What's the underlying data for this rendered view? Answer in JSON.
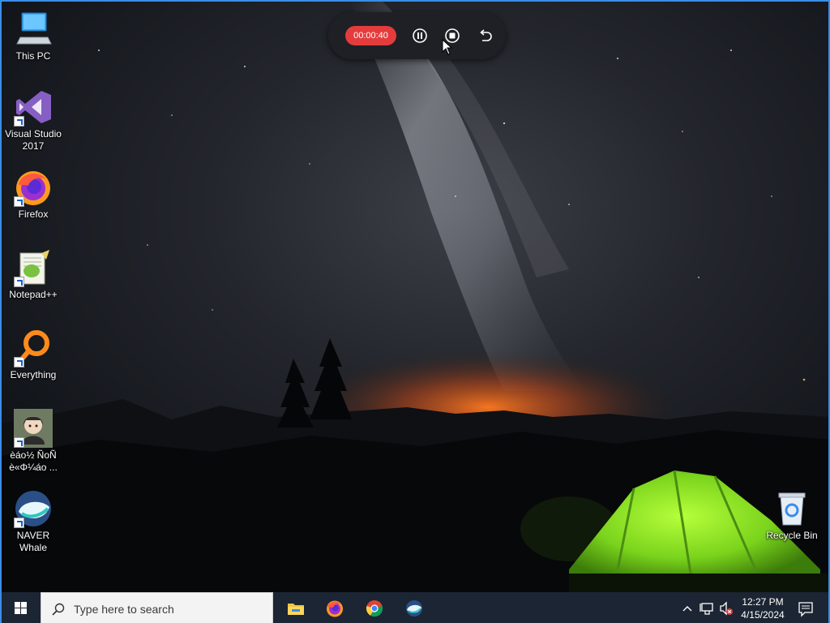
{
  "desktop": {
    "icons": [
      {
        "label": "This PC",
        "icon": "this-pc-icon"
      },
      {
        "label": "Visual Studio 2017",
        "icon": "visual-studio-icon"
      },
      {
        "label": "Firefox",
        "icon": "firefox-icon"
      },
      {
        "label": "Notepad++",
        "icon": "notepadpp-icon"
      },
      {
        "label": "Everything",
        "icon": "everything-icon"
      },
      {
        "label": "èáo½ ÑoÑ è«Φ¼áo ...",
        "icon": "user-avatar-icon"
      },
      {
        "label": "NAVER Whale",
        "icon": "naver-whale-icon"
      },
      {
        "label": "Recycle Bin",
        "icon": "recycle-bin-icon"
      }
    ]
  },
  "recorder": {
    "time": "00:00:40",
    "buttons": [
      "pause-icon",
      "stop-icon",
      "undo-icon"
    ],
    "accent": "#e43c3c"
  },
  "taskbar": {
    "search_placeholder": "Type here to search",
    "apps": [
      "file-explorer-icon",
      "firefox-icon",
      "chrome-icon",
      "naver-whale-icon"
    ],
    "clock": {
      "time": "12:27 PM",
      "date": "4/15/2024"
    }
  }
}
